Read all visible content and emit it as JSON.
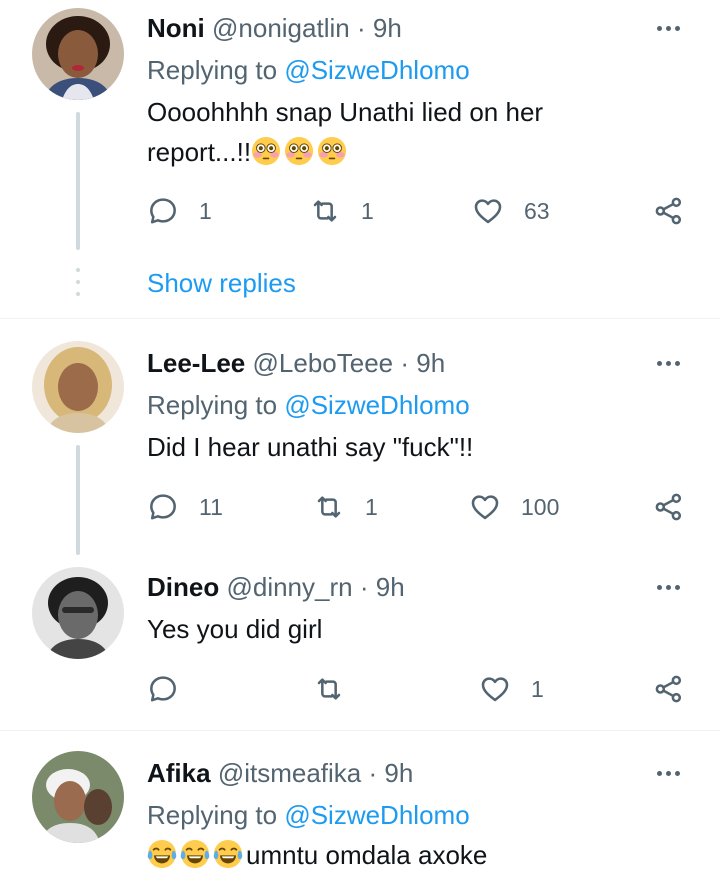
{
  "colors": {
    "accent": "#1d9bf0",
    "muted": "#536471",
    "text": "#0f1419",
    "line": "#cfd9de"
  },
  "tweets": [
    {
      "name": "Noni",
      "handle": "@nonigatlin",
      "separator": "·",
      "time": "9h",
      "replying_prefix": "Replying to",
      "replying_to": "@SizweDhlomo",
      "text": "Oooohhhh snap Unathi lied on her report...!!",
      "emojis": [
        "flushed-face",
        "flushed-face",
        "flushed-face"
      ],
      "replies": "1",
      "retweets": "1",
      "likes": "63",
      "show_replies": "Show replies"
    },
    {
      "name": "Lee-Lee",
      "handle": "@LeboTeee",
      "separator": "·",
      "time": "9h",
      "replying_prefix": "Replying to",
      "replying_to": "@SizweDhlomo",
      "text": "Did I hear unathi say \"fuck\"!!",
      "replies": "11",
      "retweets": "1",
      "likes": "100"
    },
    {
      "name": "Dineo",
      "handle": "@dinny_rn",
      "separator": "·",
      "time": "9h",
      "text": "Yes you did girl",
      "replies": "",
      "retweets": "",
      "likes": "1"
    },
    {
      "name": "Afika",
      "handle": "@itsmeafika",
      "separator": "·",
      "time": "9h",
      "replying_prefix": "Replying to",
      "replying_to": "@SizweDhlomo",
      "emojis": [
        "tears-of-joy-face",
        "tears-of-joy-face",
        "tears-of-joy-face"
      ],
      "text": "umntu omdala axoke"
    }
  ]
}
